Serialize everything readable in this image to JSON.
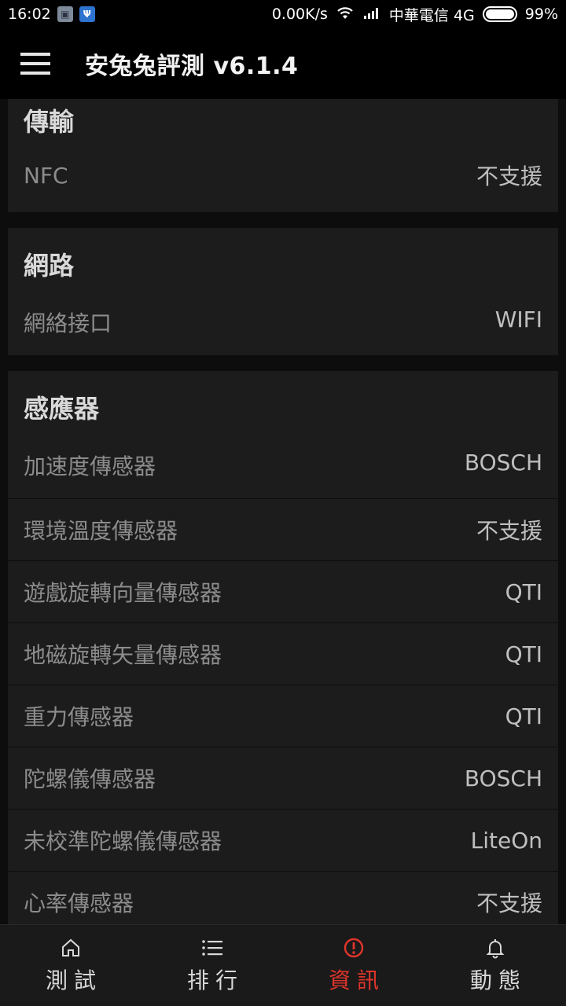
{
  "status_bar": {
    "time": "16:02",
    "net_speed": "0.00K/s",
    "carrier": "中華電信 4G",
    "battery": "99%"
  },
  "app_bar": {
    "title": "安兔兔評測 v6.1.4"
  },
  "sections": {
    "transport": {
      "title": "傳輸",
      "rows": [
        {
          "label": "NFC",
          "value": "不支援"
        }
      ]
    },
    "network": {
      "title": "網路",
      "rows": [
        {
          "label": "網絡接口",
          "value": "WIFI"
        }
      ]
    },
    "sensors": {
      "title": "感應器",
      "rows": [
        {
          "label": "加速度傳感器",
          "value": "BOSCH"
        },
        {
          "label": "環境溫度傳感器",
          "value": "不支援"
        },
        {
          "label": "遊戲旋轉向量傳感器",
          "value": "QTI"
        },
        {
          "label": "地磁旋轉矢量傳感器",
          "value": "QTI"
        },
        {
          "label": "重力傳感器",
          "value": "QTI"
        },
        {
          "label": "陀螺儀傳感器",
          "value": "BOSCH"
        },
        {
          "label": "未校準陀螺儀傳感器",
          "value": "LiteOn"
        },
        {
          "label": "心率傳感器",
          "value": "不支援"
        }
      ]
    }
  },
  "bottom_nav": {
    "items": [
      {
        "label": "測試",
        "icon": "home-icon"
      },
      {
        "label": "排行",
        "icon": "list-icon"
      },
      {
        "label": "資訊",
        "icon": "info-icon",
        "active": true
      },
      {
        "label": "動態",
        "icon": "bell-icon"
      }
    ]
  },
  "colors": {
    "accent": "#e0352b",
    "card": "#1c1c1c",
    "background": "#0d0d0d"
  }
}
